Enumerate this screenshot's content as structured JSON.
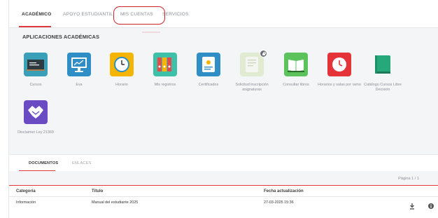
{
  "tabs": [
    {
      "label": "ACADÉMICO"
    },
    {
      "label": "APOYO ESTUDIANTIL"
    },
    {
      "label": "MIS CUENTAS"
    },
    {
      "label": "SERVICIOS"
    }
  ],
  "section_title": "APLICACIONES ACADÉMICAS",
  "apps": [
    {
      "label": "Cursos",
      "icon": "chalkboard-icon"
    },
    {
      "label": "Eva",
      "icon": "monitor-icon"
    },
    {
      "label": "Horario",
      "icon": "clock-icon"
    },
    {
      "label": "Mis registros",
      "icon": "binders-icon"
    },
    {
      "label": "Certificados",
      "icon": "certificate-icon"
    },
    {
      "label": "Solicitud inscripción asignaturas",
      "icon": "form-icon"
    },
    {
      "label": "Consultar libros",
      "icon": "book-icon"
    },
    {
      "label": "Horarios y salas por ramo",
      "icon": "red-clock-icon"
    },
    {
      "label": "Catálogo Cursos Libre Decisión",
      "icon": "catalog-icon"
    },
    {
      "label": "Disclaimer Ley 21369",
      "icon": "handshake-icon"
    }
  ],
  "colors": {
    "accent": "#e03a3e"
  },
  "docs": {
    "tabs": [
      {
        "label": "DOCUMENTOS"
      },
      {
        "label": "ENLACES"
      }
    ],
    "pager": "Página 1 / 1",
    "columns": {
      "categoria": "Categoría",
      "titulo": "Título",
      "fecha": "Fecha actualización"
    },
    "rows": [
      {
        "categoria": "Información",
        "titulo": "Manual del estudiante 2025",
        "fecha": "27-03-2025 15:36"
      }
    ]
  }
}
